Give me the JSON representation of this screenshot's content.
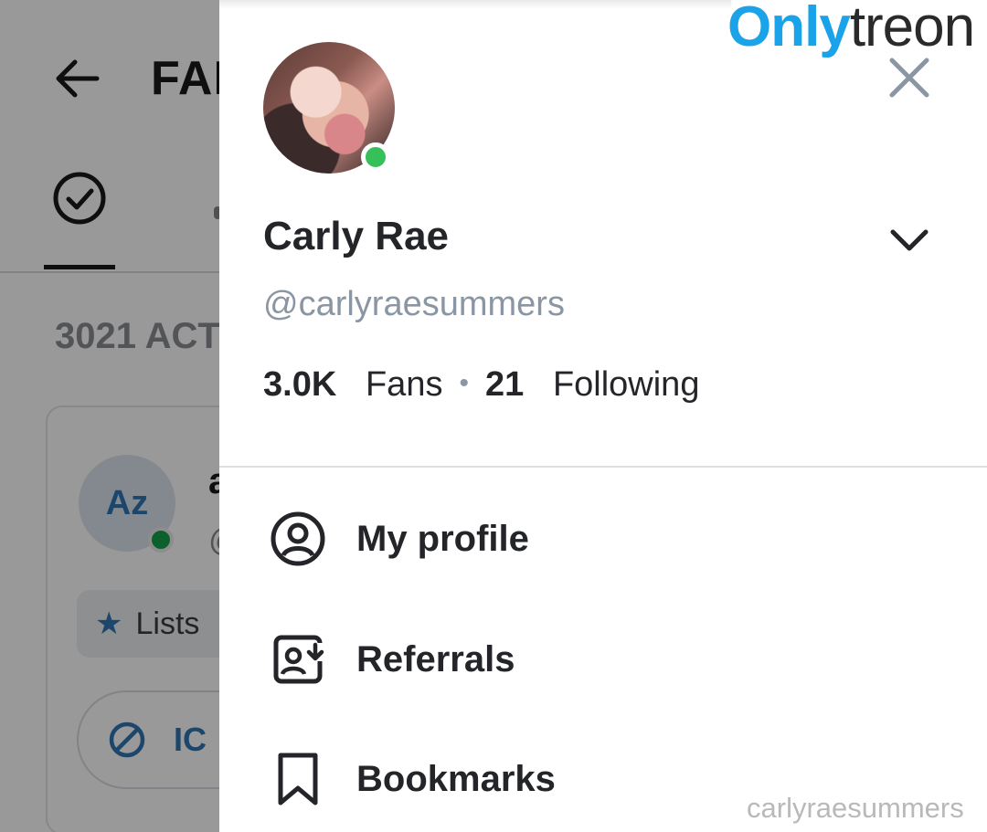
{
  "background": {
    "title_fragment": "FAI",
    "count_fragment": "3021 ACT",
    "card": {
      "avatar_initials": "Az",
      "name_fragment": "a",
      "handle_fragment": "@",
      "lists_label": "Lists",
      "ignore_fragment": "IC"
    }
  },
  "drawer": {
    "display_name": "Carly Rae",
    "username": "@carlyraesummers",
    "fans_count": "3.0K",
    "fans_label": "Fans",
    "separator": "•",
    "following_count": "21",
    "following_label": "Following",
    "menu": [
      {
        "label": "My profile",
        "icon": "user-circle-icon"
      },
      {
        "label": "Referrals",
        "icon": "referral-icon"
      },
      {
        "label": "Bookmarks",
        "icon": "bookmark-icon"
      }
    ]
  },
  "watermark": {
    "logo_part1": "Only",
    "logo_part2": "treon",
    "username": "carlyraesummers"
  },
  "colors": {
    "online": "#35c05a",
    "accent": "#2f76b4",
    "muted_text": "#8a96a3",
    "logo_blue": "#1aa3e8"
  }
}
